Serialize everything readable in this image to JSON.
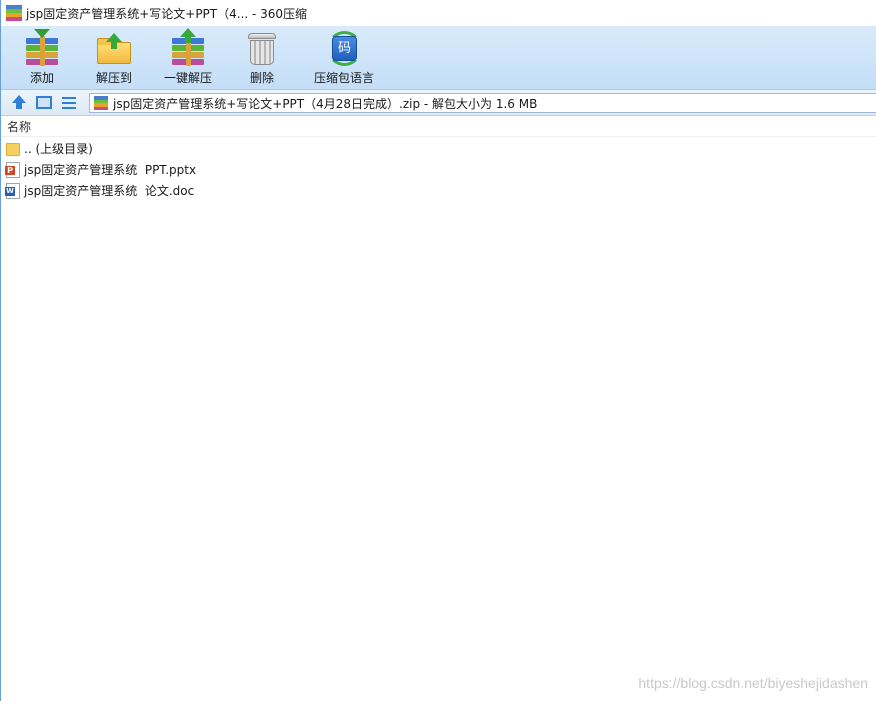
{
  "window": {
    "title": "jsp固定资产管理系统+写论文+PPT（4... - 360压缩"
  },
  "toolbar": {
    "buttons": [
      {
        "label": "添加",
        "icon": "add-archive-icon"
      },
      {
        "label": "解压到",
        "icon": "extract-to-icon"
      },
      {
        "label": "一键解压",
        "icon": "one-click-extract-icon"
      },
      {
        "label": "删除",
        "icon": "delete-trash-icon"
      },
      {
        "label": "压缩包语言",
        "icon": "archive-encoding-icon"
      }
    ],
    "encoding_glyph": "码"
  },
  "navbar": {
    "address": "jsp固定资产管理系统+写论文+PPT（4月28日完成）.zip - 解包大小为 1.6 MB"
  },
  "list": {
    "header_name": "名称",
    "rows": [
      {
        "label": ".. (上级目录)",
        "icon": "folder-icon"
      },
      {
        "label": "jsp固定资产管理系统  PPT.pptx",
        "icon": "pptx-file-icon"
      },
      {
        "label": "jsp固定资产管理系统  论文.doc",
        "icon": "doc-file-icon"
      }
    ]
  },
  "watermark": "https://blog.csdn.net/biyeshejidashen",
  "colors": {
    "toolbar_top": "#d9ebfb",
    "toolbar_bottom": "#c4def7",
    "accent_blue": "#2f7fd6"
  }
}
